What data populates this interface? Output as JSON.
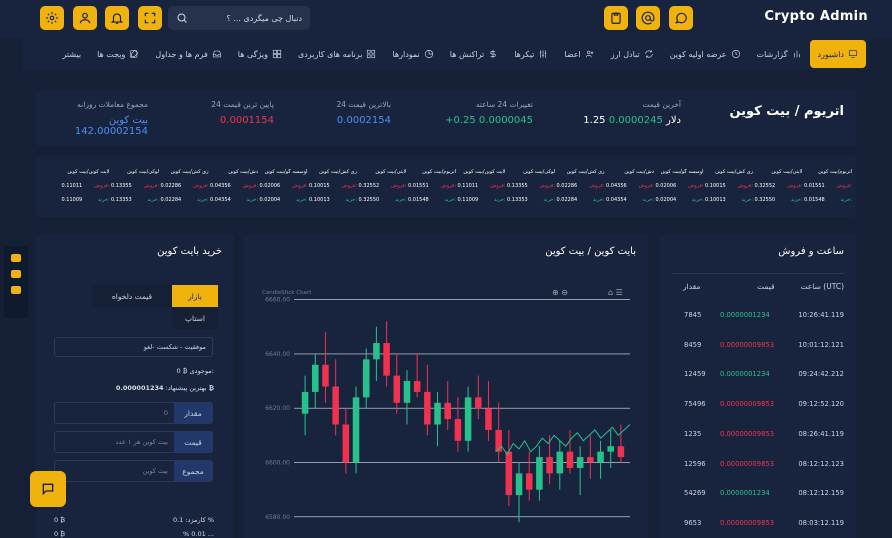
{
  "header": {
    "brand": "Crypto Admin",
    "search_placeholder": "دنبال چی میگردی ... ؟",
    "icons_left": [
      "gear-icon",
      "user-icon",
      "bell-icon",
      "fullscreen-icon",
      "search-icon"
    ],
    "icons_right": [
      "clipboard-icon",
      "at-icon",
      "chat-icon"
    ]
  },
  "nav": {
    "items": [
      {
        "label": "داشبورد",
        "icon": "monitor-icon",
        "active": true
      },
      {
        "label": "گزارشات",
        "icon": "bars-icon",
        "active": false
      },
      {
        "label": "عرضه اولیه کوین",
        "icon": "clock-icon",
        "active": false
      },
      {
        "label": "تبادل ارز",
        "icon": "exchange-icon",
        "active": false
      },
      {
        "label": "اعضا",
        "icon": "users-icon",
        "active": false
      },
      {
        "label": "تیکرها",
        "icon": "sliders-icon",
        "active": false
      },
      {
        "label": "تراکنش ها",
        "icon": "dollar-icon",
        "active": false
      },
      {
        "label": "نمودارها",
        "icon": "pie-icon",
        "active": false
      },
      {
        "label": "برنامه های کاربردی",
        "icon": "apps-icon",
        "active": false
      },
      {
        "label": "ویژگی ها",
        "icon": "grid-icon",
        "active": false
      },
      {
        "label": "فرم ها و جداول",
        "icon": "inbox-icon",
        "active": false
      },
      {
        "label": "ویجت ها",
        "icon": "edit-icon",
        "active": false
      },
      {
        "label": "بیشتر",
        "icon": "",
        "active": false
      }
    ]
  },
  "stats": {
    "pair_title": "اتریوم / بیت کوین",
    "last_price_label": "آخرین قیمت",
    "last_price_btc": "0.0000245",
    "last_price_usd": "1.25 دلار",
    "change_label": "تغییرات 24 ساعته",
    "change_value": "0.0000045",
    "change_pct": "+0.25",
    "high_label": "بالاترین قیمت 24",
    "high_value": "0.0002154",
    "low_label": "پایین ترین قیمت 24",
    "low_value": "0.0001154",
    "volume_label": "مجموع معاملات روزانه",
    "volume_value": "142.00002154",
    "volume_unit": "بیت کوین"
  },
  "tickers": [
    {
      "name": "اتریوم/بیت کوین",
      "sell_label": "فروش:",
      "sell": "0.01551",
      "buy_label": "خرید:",
      "buy": "0.01548"
    },
    {
      "name": "لایتی/بیت کوین",
      "sell_label": "فروش:",
      "sell": "0.32552",
      "buy_label": "خرید:",
      "buy": "0.32550"
    },
    {
      "name": "زی کش/بیت کوین",
      "sell_label": "فروش:",
      "sell": "0.10015",
      "buy_label": "خرید:",
      "buy": "0.10013"
    },
    {
      "name": "اومیسه گو/بیت کوین",
      "sell_label": "فروش:",
      "sell": "0.02006",
      "buy_label": "خرید:",
      "buy": "0.02004"
    },
    {
      "name": "دش/بیت کوین",
      "sell_label": "فروش:",
      "sell": "0.04356",
      "buy_label": "خرید:",
      "buy": "0.04354"
    },
    {
      "name": "زی کش/بیت کوین",
      "sell_label": "فروش:",
      "sell": "0.02286",
      "buy_label": "خرید:",
      "buy": "0.02284"
    },
    {
      "name": "لوکی/بیت کوین",
      "sell_label": "فروش:",
      "sell": "0.13355",
      "buy_label": "خرید:",
      "buy": "0.13353"
    },
    {
      "name": "لایت کوین/بیت کوین",
      "sell_label": "فروش:",
      "sell": "0.11011",
      "buy_label": "خرید:",
      "buy": "0.11009"
    },
    {
      "name": "اتریوم/بیت کوین",
      "sell_label": "فروش:",
      "sell": "0.01551",
      "buy_label": "خرید:",
      "buy": "0.01548"
    },
    {
      "name": "لایتی/بیت کوین",
      "sell_label": "فروش:",
      "sell": "0.32552",
      "buy_label": "خرید:",
      "buy": "0.32550"
    },
    {
      "name": "زی کش/بیت کوین",
      "sell_label": "فروش:",
      "sell": "0.10015",
      "buy_label": "خرید:",
      "buy": "0.10013"
    },
    {
      "name": "اومیسه گو/بیت کوین",
      "sell_label": "فروش:",
      "sell": "0.02006",
      "buy_label": "خرید:",
      "buy": "0.02004"
    },
    {
      "name": "دش/بیت کوین",
      "sell_label": "فروش:",
      "sell": "0.04356",
      "buy_label": "خرید:",
      "buy": "0.04354"
    },
    {
      "name": "زی کش/بیت کوین",
      "sell_label": "فروش:",
      "sell": "0.02286",
      "buy_label": "خرید:",
      "buy": "0.02284"
    },
    {
      "name": "لوکی/بیت کوین",
      "sell_label": "فروش:",
      "sell": "0.13355",
      "buy_label": "خرید:",
      "buy": "0.13353"
    },
    {
      "name": "لایت کوین/بیت کوین",
      "sell_label": "فروش:",
      "sell": "0.11011",
      "buy_label": "خرید:",
      "buy": "0.11009"
    }
  ],
  "buy_panel": {
    "title": "خرید بایت کوین",
    "tab_market": "بازار",
    "tab_limit": "قیمت دلخواه",
    "tab_stop": "استاپ",
    "mode": "موفقیت - شکست -لغو",
    "balance_label": "موجودی:",
    "balance_value": "0 ₿",
    "best_offer_label": "بهترین پیشنهاد:",
    "best_offer_value": "0.000001234 ₿",
    "amount_label": "مقدار",
    "amount_placeholder": "0",
    "price_label": "قیمت",
    "price_placeholder": "بیت کوین هر ۱ عدد",
    "total_label": "مجموع",
    "total_placeholder": "بیت کوین",
    "fee_label": "کارمزد: 0.1 %",
    "fee_value": "0 ₿",
    "fee2_label": "% 0.01 ...",
    "fee2_value": "0 ₿"
  },
  "chart_panel": {
    "title": "بایت کوین / بیت کوین",
    "chart_caption": "CandleStick Chart"
  },
  "chart_data": {
    "type": "candlestick",
    "yticks": [
      6580,
      6600,
      6620,
      6640,
      6660
    ],
    "ylim": [
      6570,
      6665
    ],
    "candles": [
      [
        6618,
        6632,
        6610,
        6626
      ],
      [
        6626,
        6640,
        6620,
        6636
      ],
      [
        6636,
        6648,
        6622,
        6628
      ],
      [
        6628,
        6638,
        6610,
        6614
      ],
      [
        6614,
        6620,
        6596,
        6600
      ],
      [
        6600,
        6628,
        6596,
        6624
      ],
      [
        6624,
        6642,
        6620,
        6638
      ],
      [
        6638,
        6650,
        6630,
        6644
      ],
      [
        6644,
        6652,
        6628,
        6632
      ],
      [
        6632,
        6640,
        6618,
        6622
      ],
      [
        6622,
        6634,
        6614,
        6630
      ],
      [
        6630,
        6640,
        6624,
        6626
      ],
      [
        6626,
        6636,
        6610,
        6614
      ],
      [
        6614,
        6626,
        6606,
        6622
      ],
      [
        6622,
        6630,
        6612,
        6616
      ],
      [
        6616,
        6624,
        6604,
        6608
      ],
      [
        6608,
        6628,
        6604,
        6624
      ],
      [
        6624,
        6632,
        6616,
        6620
      ],
      [
        6620,
        6630,
        6608,
        6612
      ],
      [
        6612,
        6622,
        6600,
        6604
      ],
      [
        6604,
        6612,
        6584,
        6588
      ],
      [
        6588,
        6600,
        6578,
        6596
      ],
      [
        6596,
        6604,
        6586,
        6590
      ],
      [
        6590,
        6606,
        6586,
        6602
      ],
      [
        6602,
        6610,
        6592,
        6596
      ],
      [
        6596,
        6608,
        6590,
        6604
      ],
      [
        6604,
        6612,
        6596,
        6598
      ],
      [
        6598,
        6606,
        6588,
        6602
      ],
      [
        6602,
        6610,
        6594,
        6600
      ],
      [
        6600,
        6608,
        6594,
        6604
      ],
      [
        6604,
        6612,
        6598,
        6606
      ],
      [
        6606,
        6614,
        6600,
        6602
      ]
    ],
    "line": [
      6604,
      6606,
      6603,
      6607,
      6605,
      6608,
      6604,
      6606,
      6609,
      6607,
      6610,
      6608,
      6606,
      6609,
      6611,
      6608,
      6610,
      6612,
      6609,
      6611,
      6613,
      6610,
      6612,
      6614
    ]
  },
  "orderbook": {
    "title": "ساعت و فروش",
    "headers": {
      "time": "ساعت (UTC)",
      "price": "قیمت",
      "amount": "مقدار"
    },
    "rows": [
      {
        "time": "10:26:41.119",
        "price": "0.0000001234",
        "amount": "7845",
        "side": "buy"
      },
      {
        "time": "10:01:12.121",
        "price": "0.00000009853",
        "amount": "8459",
        "side": "sell"
      },
      {
        "time": "09:24:42.212",
        "price": "0.0000001234",
        "amount": "12459",
        "side": "buy"
      },
      {
        "time": "09:12:52.120",
        "price": "0.00000009853",
        "amount": "75496",
        "side": "sell"
      },
      {
        "time": "08:26:41.119",
        "price": "0.00000009853",
        "amount": "1235",
        "side": "sell"
      },
      {
        "time": "08:12:12.123",
        "price": "0.00000009853",
        "amount": "12596",
        "side": "sell"
      },
      {
        "time": "08:12:12.159",
        "price": "0.0000001234",
        "amount": "54269",
        "side": "buy"
      },
      {
        "time": "08:03:12.119",
        "price": "0.00000009853",
        "amount": "9653",
        "side": "sell"
      }
    ]
  },
  "colors": {
    "accent": "#f0b20c",
    "bg": "#152037",
    "panel": "#18243e",
    "green": "#27c28b",
    "red": "#f0324f",
    "blue": "#4f8df2"
  }
}
